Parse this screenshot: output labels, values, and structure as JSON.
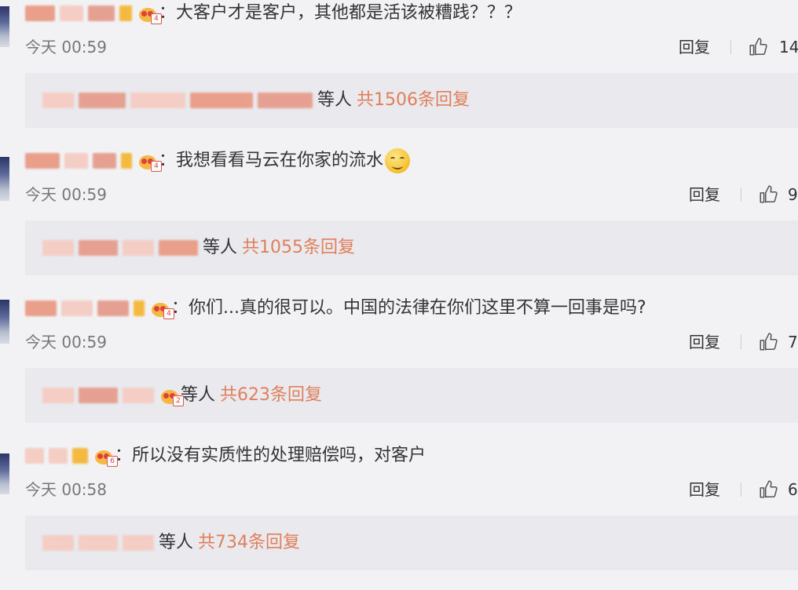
{
  "comments": [
    {
      "text": "：大客户才是客户，其他都是活该被糟践？？？",
      "emoji": "",
      "badge_level": "4",
      "time": "今天 00:59",
      "reply_label": "回复",
      "likes": "14",
      "sub_who": "等人",
      "sub_total": "共1506条回复"
    },
    {
      "text": "：我想看看马云在你家的流水",
      "emoji": "smile-emoji",
      "badge_level": "4",
      "time": "今天 00:59",
      "reply_label": "回复",
      "likes": "9",
      "sub_who": "等人",
      "sub_total": "共1055条回复"
    },
    {
      "text": "：你们...真的很可以。中国的法律在你们这里不算一回事是吗?",
      "emoji": "",
      "badge_level": "4",
      "time": "今天 00:59",
      "reply_label": "回复",
      "likes": "7",
      "sub_who": "等人",
      "sub_total": "共623条回复"
    },
    {
      "text": "：所以没有实质性的处理赔偿吗，对客户",
      "emoji": "",
      "badge_level": "6",
      "time": "今天 00:58",
      "reply_label": "回复",
      "likes": "6",
      "sub_who": "等人",
      "sub_total": "共734条回复"
    }
  ],
  "colors": {
    "background": "#f2f2f5",
    "reply_block": "#e9e9ee",
    "accent_orange": "#e07f5b",
    "muted_text": "#777777"
  },
  "icons": {
    "like": "thumbs-up-icon",
    "badge": "crown-badge-icon"
  }
}
